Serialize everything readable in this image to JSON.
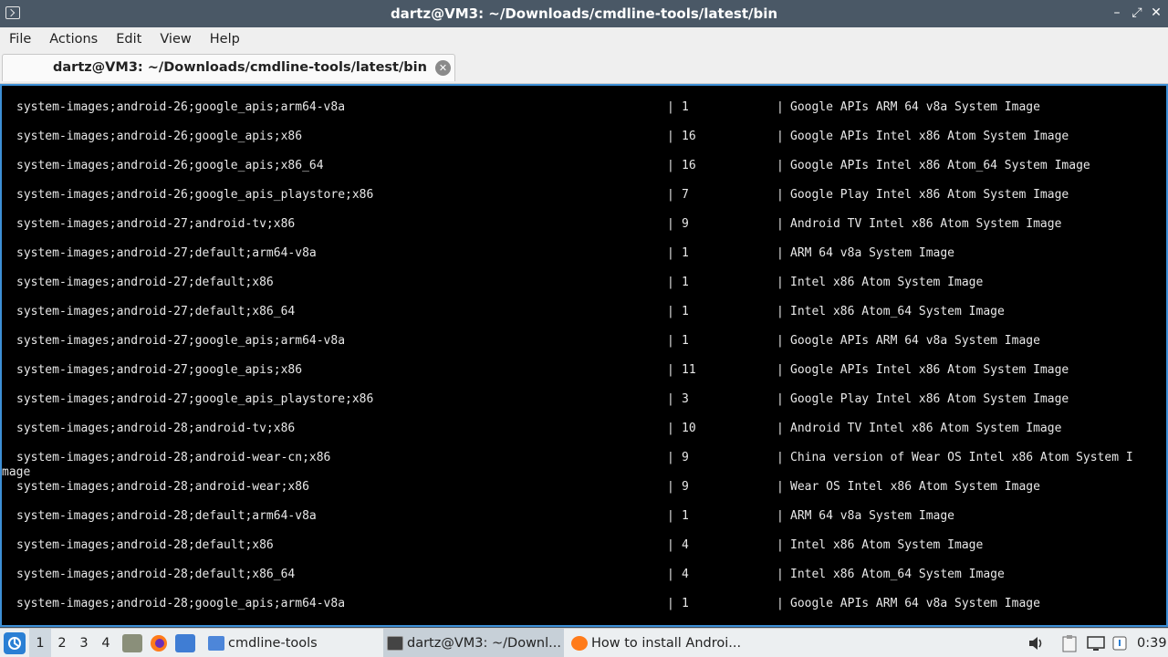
{
  "window": {
    "title": "dartz@VM3: ~/Downloads/cmdline-tools/latest/bin",
    "minimize_glyph": "–",
    "maximize_glyph": "⤢",
    "close_glyph": "✕"
  },
  "menu": {
    "file": "File",
    "actions": "Actions",
    "edit": "Edit",
    "view": "View",
    "help": "Help"
  },
  "tab": {
    "label": "dartz@VM3: ~/Downloads/cmdline-tools/latest/bin",
    "close_glyph": "✕"
  },
  "terminal": {
    "separator": "|",
    "rows": [
      {
        "path": "system-images;android-26;google_apis;arm64-v8a",
        "version": "1",
        "description": "Google APIs ARM 64 v8a System Image"
      },
      {
        "path": "system-images;android-26;google_apis;x86",
        "version": "16",
        "description": "Google APIs Intel x86 Atom System Image"
      },
      {
        "path": "system-images;android-26;google_apis;x86_64",
        "version": "16",
        "description": "Google APIs Intel x86 Atom_64 System Image"
      },
      {
        "path": "system-images;android-26;google_apis_playstore;x86",
        "version": "7",
        "description": "Google Play Intel x86 Atom System Image"
      },
      {
        "path": "system-images;android-27;android-tv;x86",
        "version": "9",
        "description": "Android TV Intel x86 Atom System Image"
      },
      {
        "path": "system-images;android-27;default;arm64-v8a",
        "version": "1",
        "description": "ARM 64 v8a System Image"
      },
      {
        "path": "system-images;android-27;default;x86",
        "version": "1",
        "description": "Intel x86 Atom System Image"
      },
      {
        "path": "system-images;android-27;default;x86_64",
        "version": "1",
        "description": "Intel x86 Atom_64 System Image"
      },
      {
        "path": "system-images;android-27;google_apis;arm64-v8a",
        "version": "1",
        "description": "Google APIs ARM 64 v8a System Image"
      },
      {
        "path": "system-images;android-27;google_apis;x86",
        "version": "11",
        "description": "Google APIs Intel x86 Atom System Image"
      },
      {
        "path": "system-images;android-27;google_apis_playstore;x86",
        "version": "3",
        "description": "Google Play Intel x86 Atom System Image"
      },
      {
        "path": "system-images;android-28;android-tv;x86",
        "version": "10",
        "description": "Android TV Intel x86 Atom System Image"
      },
      {
        "path": "system-images;android-28;android-wear-cn;x86",
        "version": "9",
        "description": "China version of Wear OS Intel x86 Atom System I",
        "wrap": "mage"
      },
      {
        "path": "system-images;android-28;android-wear;x86",
        "version": "9",
        "description": "Wear OS Intel x86 Atom System Image"
      },
      {
        "path": "system-images;android-28;default;arm64-v8a",
        "version": "1",
        "description": "ARM 64 v8a System Image"
      },
      {
        "path": "system-images;android-28;default;x86",
        "version": "4",
        "description": "Intel x86 Atom System Image"
      },
      {
        "path": "system-images;android-28;default;x86_64",
        "version": "4",
        "description": "Intel x86 Atom_64 System Image"
      },
      {
        "path": "system-images;android-28;google_apis;arm64-v8a",
        "version": "1",
        "description": "Google APIs ARM 64 v8a System Image"
      }
    ]
  },
  "taskbar": {
    "workspaces": [
      "1",
      "2",
      "3",
      "4"
    ],
    "active_workspace": "1",
    "tasks": [
      {
        "label": "cmdline-tools",
        "icon": "folder-icon"
      },
      {
        "label": "dartz@VM3: ~/Downl...",
        "icon": "terminal-icon"
      },
      {
        "label": "How to install Androi...",
        "icon": "firefox-icon"
      }
    ],
    "clock": "0:39",
    "colors": {
      "accent": "#2a7fd4",
      "terminal_border": "#3d8fd6"
    }
  }
}
